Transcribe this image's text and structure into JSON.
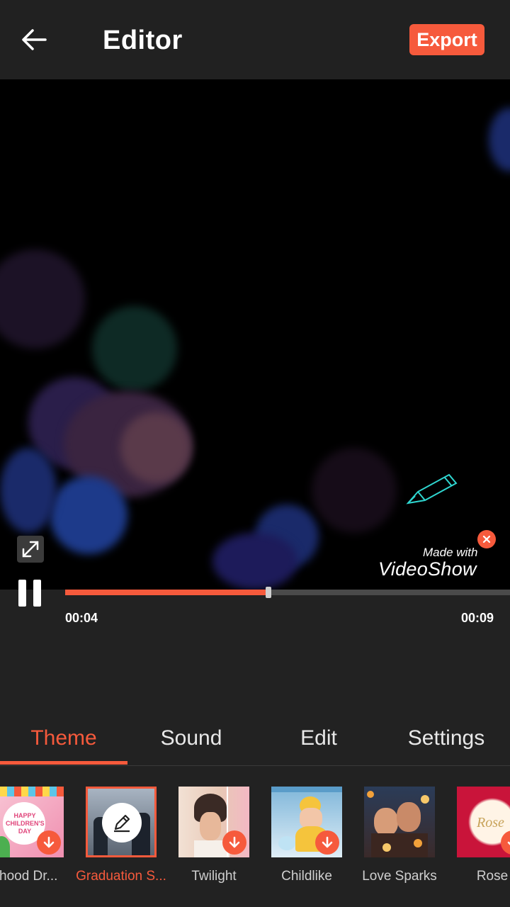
{
  "header": {
    "title": "Editor",
    "export_label": "Export"
  },
  "preview": {
    "watermark_made": "Made with",
    "watermark_brand": "VideoShow"
  },
  "player": {
    "current_time": "00:04",
    "total_time": "00:09",
    "progress": 0.45
  },
  "tabs": [
    "Theme",
    "Sound",
    "Edit",
    "Settings"
  ],
  "active_tab": "Theme",
  "themes": [
    {
      "label": "ildhood Dr...",
      "thumb_text": "HAPPY CHILDREN'S DAY"
    },
    {
      "label": "Graduation S..."
    },
    {
      "label": "Twilight"
    },
    {
      "label": "Childlike"
    },
    {
      "label": "Love Sparks"
    },
    {
      "label": "Rose",
      "thumb_text": "Rose"
    }
  ],
  "colors": {
    "accent": "#f65a3c",
    "background": "#222222",
    "preview": "#000000"
  },
  "icons": [
    "back-arrow-icon",
    "fullscreen-icon",
    "close-icon",
    "pause-icon",
    "download-icon",
    "edit-pencil-icon"
  ]
}
